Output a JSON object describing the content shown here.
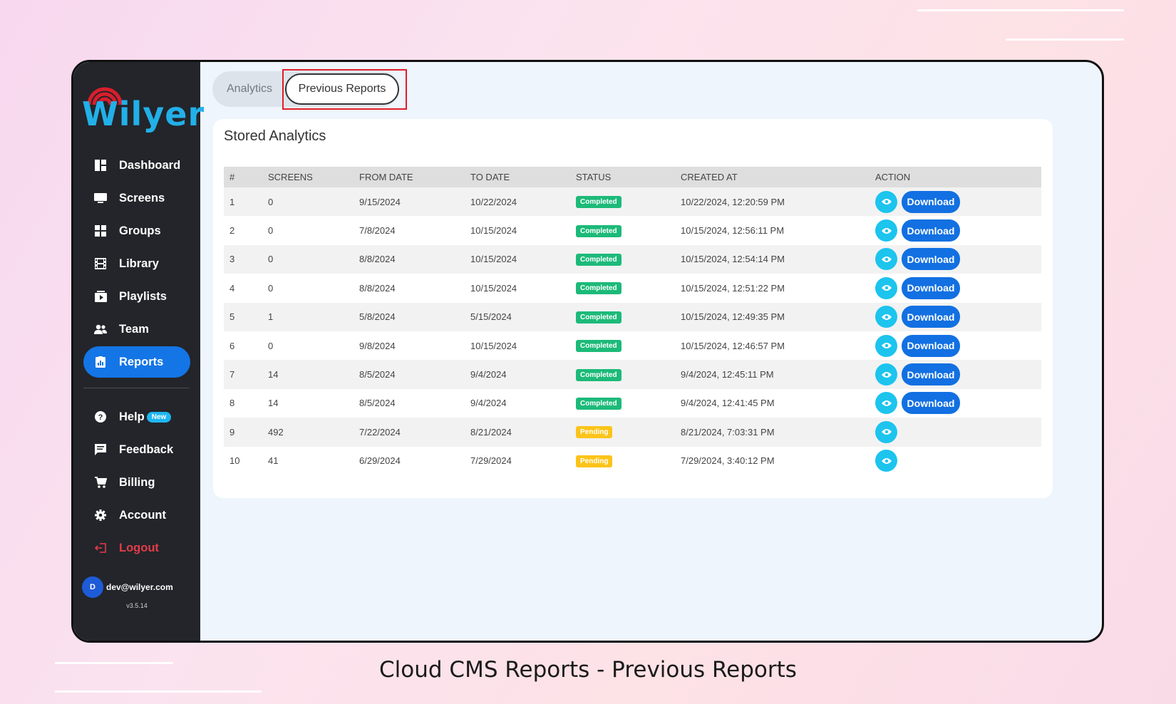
{
  "brand": {
    "name": "Wilyer",
    "color": "#22b0e8",
    "accent_red": "#d81e2c"
  },
  "sidebar": {
    "items": [
      {
        "label": "Dashboard",
        "icon": "dashboard-icon"
      },
      {
        "label": "Screens",
        "icon": "monitor-icon"
      },
      {
        "label": "Groups",
        "icon": "grid-icon"
      },
      {
        "label": "Library",
        "icon": "film-icon"
      },
      {
        "label": "Playlists",
        "icon": "playlist-icon"
      },
      {
        "label": "Team",
        "icon": "team-icon"
      },
      {
        "label": "Reports",
        "icon": "reports-icon",
        "active": true
      }
    ],
    "secondary": [
      {
        "label": "Help",
        "icon": "help-icon",
        "badge": "New"
      },
      {
        "label": "Feedback",
        "icon": "feedback-icon"
      },
      {
        "label": "Billing",
        "icon": "cart-icon"
      },
      {
        "label": "Account",
        "icon": "gear-icon"
      },
      {
        "label": "Logout",
        "icon": "logout-icon"
      }
    ],
    "user": {
      "initial": "D",
      "email": "dev@wilyer.com"
    },
    "version": "v3.5.14"
  },
  "tabs": {
    "analytics": "Analytics",
    "previous_reports": "Previous Reports"
  },
  "card": {
    "title": "Stored Analytics"
  },
  "table": {
    "headers": [
      "#",
      "SCREENS",
      "FROM DATE",
      "TO DATE",
      "STATUS",
      "CREATED AT",
      "ACTION"
    ],
    "download_label": "Download",
    "rows": [
      {
        "num": "1",
        "screens": "0",
        "from": "9/15/2024",
        "to": "10/22/2024",
        "status": "Completed",
        "created": "10/22/2024, 12:20:59 PM"
      },
      {
        "num": "2",
        "screens": "0",
        "from": "7/8/2024",
        "to": "10/15/2024",
        "status": "Completed",
        "created": "10/15/2024, 12:56:11 PM"
      },
      {
        "num": "3",
        "screens": "0",
        "from": "8/8/2024",
        "to": "10/15/2024",
        "status": "Completed",
        "created": "10/15/2024, 12:54:14 PM"
      },
      {
        "num": "4",
        "screens": "0",
        "from": "8/8/2024",
        "to": "10/15/2024",
        "status": "Completed",
        "created": "10/15/2024, 12:51:22 PM"
      },
      {
        "num": "5",
        "screens": "1",
        "from": "5/8/2024",
        "to": "5/15/2024",
        "status": "Completed",
        "created": "10/15/2024, 12:49:35 PM"
      },
      {
        "num": "6",
        "screens": "0",
        "from": "9/8/2024",
        "to": "10/15/2024",
        "status": "Completed",
        "created": "10/15/2024, 12:46:57 PM"
      },
      {
        "num": "7",
        "screens": "14",
        "from": "8/5/2024",
        "to": "9/4/2024",
        "status": "Completed",
        "created": "9/4/2024, 12:45:11 PM"
      },
      {
        "num": "8",
        "screens": "14",
        "from": "8/5/2024",
        "to": "9/4/2024",
        "status": "Completed",
        "created": "9/4/2024, 12:41:45 PM"
      },
      {
        "num": "9",
        "screens": "492",
        "from": "7/22/2024",
        "to": "8/21/2024",
        "status": "Pending",
        "created": "8/21/2024, 7:03:31 PM"
      },
      {
        "num": "10",
        "screens": "41",
        "from": "6/29/2024",
        "to": "7/29/2024",
        "status": "Pending",
        "created": "7/29/2024, 3:40:12 PM"
      }
    ]
  },
  "caption": "Cloud CMS Reports - Previous Reports",
  "colors": {
    "sidebar_bg": "#23252a",
    "active_nav": "#1475e6",
    "completed": "#1cba79",
    "pending": "#fcc419",
    "view_button": "#1cc4ee",
    "download_button": "#1270e2",
    "highlight_box": "#e01d2a"
  }
}
